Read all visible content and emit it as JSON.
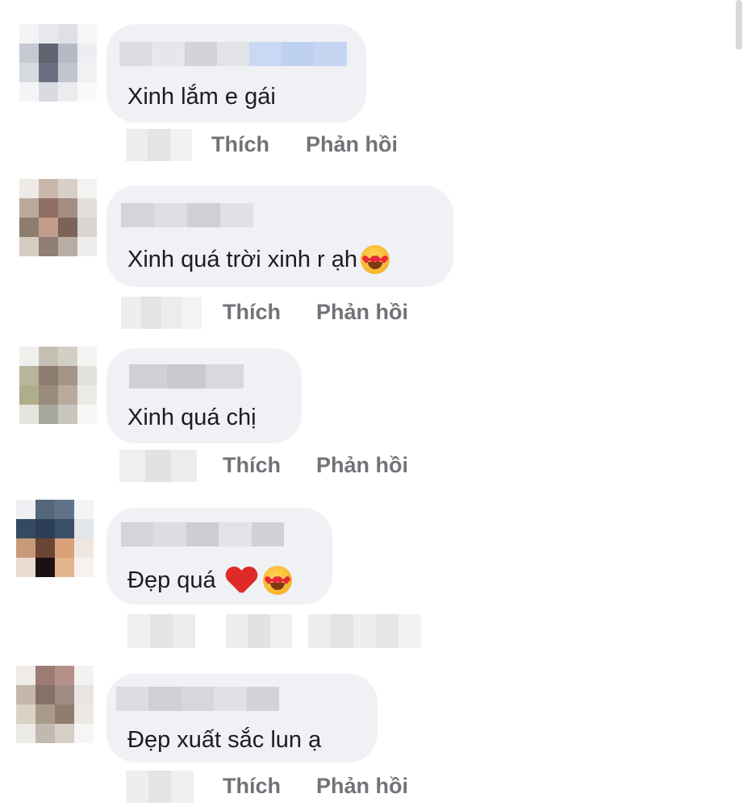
{
  "comments": [
    {
      "text": "Xinh lắm e gái",
      "emojis": [],
      "like_label": "Thích",
      "reply_label": "Phản hồi"
    },
    {
      "text": "Xinh quá trời xinh r ạh",
      "emojis": [
        "smiling-face-with-heart-eyes"
      ],
      "like_label": "Thích",
      "reply_label": "Phản hồi"
    },
    {
      "text": "Xinh quá chị",
      "emojis": [],
      "like_label": "Thích",
      "reply_label": "Phản hồi"
    },
    {
      "text": "Đẹp quá",
      "emojis": [
        "red-heart",
        "smiling-face-with-heart-eyes"
      ]
    },
    {
      "text": "Đẹp xuất sắc lun ạ",
      "emojis": [],
      "like_label": "Thích",
      "reply_label": "Phản hồi"
    }
  ],
  "colors": {
    "bubble": "#eff1f4",
    "text": "#1c1c1e",
    "action": "#707377",
    "name_link_blur": "#c9d8f3"
  }
}
